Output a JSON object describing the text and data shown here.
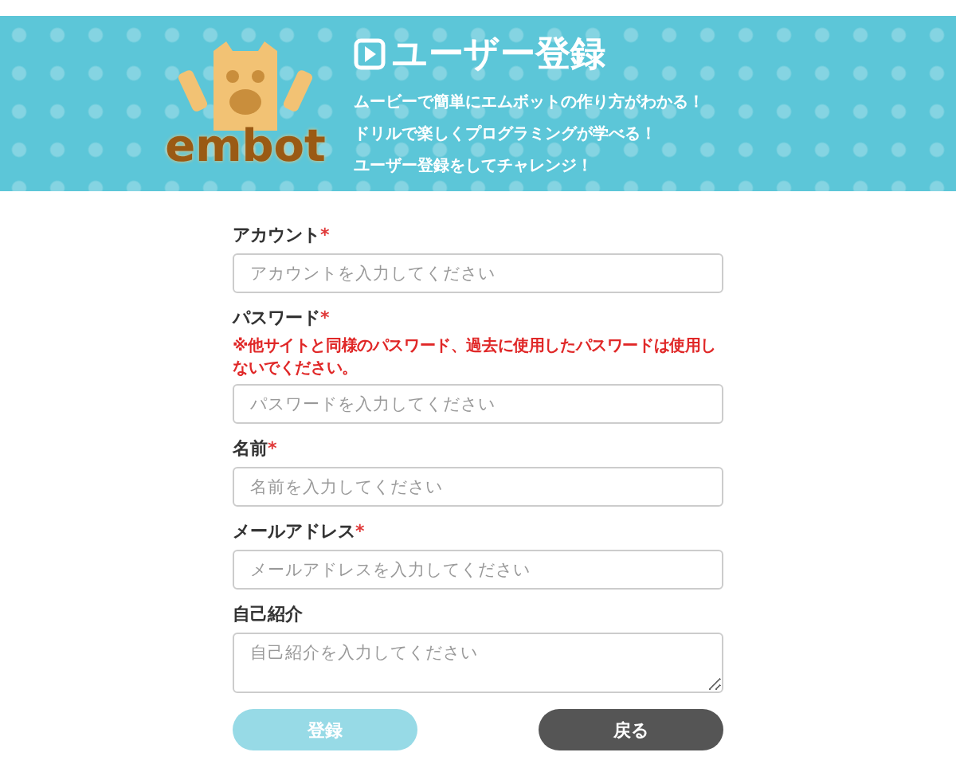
{
  "header": {
    "logo_text": "embot",
    "title": "ユーザー登録",
    "lines": [
      "ムービーで簡単にエムボットの作り方がわかる！",
      "ドリルで楽しくプログラミングが学べる！",
      "ユーザー登録をしてチャレンジ！"
    ]
  },
  "fields": [
    {
      "kind": "input",
      "label": "アカウント",
      "mark": "*",
      "placeholder": "アカウントを入力してください"
    },
    {
      "kind": "input",
      "label": "パスワード",
      "mark": "*",
      "note": "※他サイトと同様のパスワード、過去に使用したパスワードは使用しないでください。",
      "placeholder": "パスワードを入力してください"
    },
    {
      "kind": "input",
      "label": "名前",
      "mark": "*",
      "placeholder": "名前を入力してください"
    },
    {
      "kind": "input",
      "label": "メールアドレス",
      "mark": "*",
      "placeholder": "メールアドレスを入力してください"
    },
    {
      "kind": "textarea",
      "label": "自己紹介",
      "placeholder": "自己紹介を入力してください"
    }
  ],
  "buttons": [
    {
      "kind": "primary",
      "label": "登録",
      "disabled": true
    },
    {
      "kind": "secondary",
      "label": "戻る",
      "disabled": false
    }
  ]
}
